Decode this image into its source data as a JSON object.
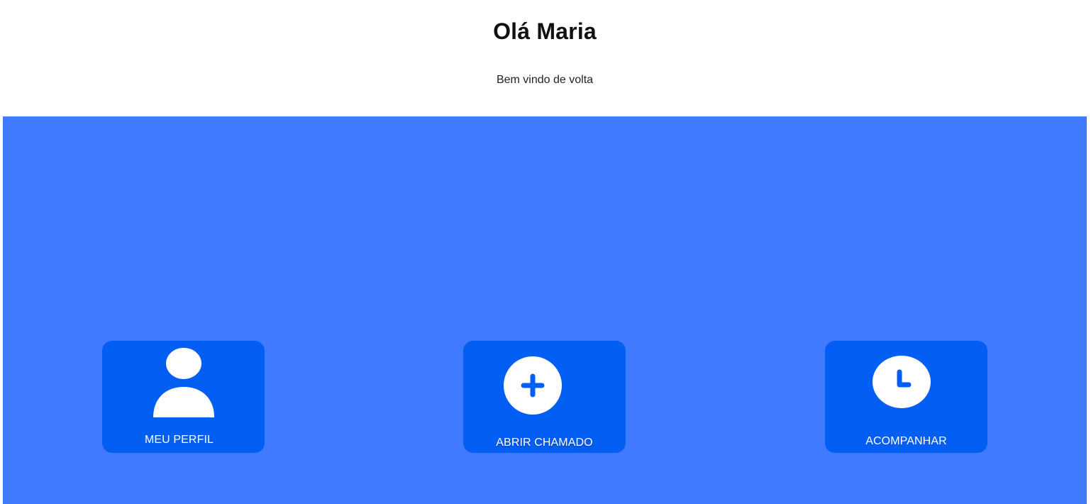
{
  "header": {
    "title": "Olá Maria",
    "subtitle": "Bem vindo de volta"
  },
  "colors": {
    "panel": "#407bff",
    "card": "#035ef3",
    "icon": "#ffffff",
    "text_on_blue": "#ffffff"
  },
  "cards": [
    {
      "label": "MEU PERFIL",
      "icon": "user-icon"
    },
    {
      "label": "ABRIR CHAMADO",
      "icon": "plus-circle-icon"
    },
    {
      "label": "ACOMPANHAR",
      "icon": "clock-icon"
    }
  ]
}
